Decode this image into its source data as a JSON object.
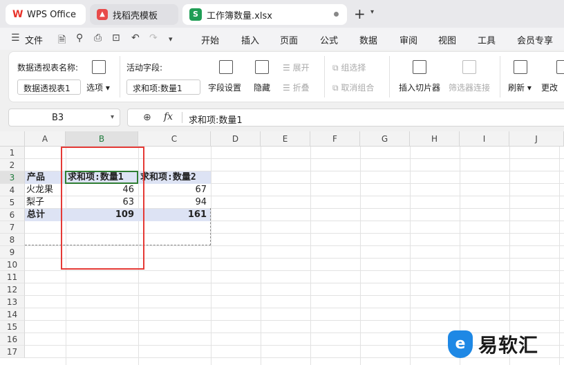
{
  "tabs": [
    {
      "label": "WPS Office",
      "icon": "wps-logo-icon"
    },
    {
      "label": "找稻壳模板",
      "icon": "template-logo-icon"
    },
    {
      "label": "工作簿数量.xlsx",
      "icon": "spreadsheet-s-icon"
    }
  ],
  "new_tab": "+",
  "menu": {
    "file": "文件",
    "items": [
      "开始",
      "插入",
      "页面",
      "公式",
      "数据",
      "审阅",
      "视图",
      "工具",
      "会员专享"
    ]
  },
  "ribbon": {
    "pivot_name_label": "数据透视表名称:",
    "pivot_name_value": "数据透视表1",
    "options_label": "选项",
    "active_field_label": "活动字段:",
    "active_field_value": "求和项:数量1",
    "field_settings": "字段设置",
    "hide": "隐藏",
    "expand": "展开",
    "collapse": "折叠",
    "group_selection": "组选择",
    "ungroup": "取消组合",
    "insert_slicer": "插入切片器",
    "filter_connections": "筛选器连接",
    "refresh": "刷新",
    "change_source": "更改"
  },
  "formula_bar": {
    "cell_ref": "B3",
    "fx": "fx",
    "value": "求和项:数量1"
  },
  "sheet": {
    "columns": [
      "A",
      "B",
      "C",
      "D",
      "E",
      "F",
      "G",
      "H",
      "I",
      "J"
    ],
    "rows": [
      "1",
      "2",
      "3",
      "4",
      "5",
      "6",
      "7",
      "8",
      "9",
      "10",
      "11",
      "12",
      "13",
      "14",
      "15",
      "16",
      "17"
    ],
    "selected_column": "B",
    "selected_row": "3",
    "pivot": {
      "header": [
        "产品",
        "求和项:数量1",
        "求和项:数量2"
      ],
      "rows": [
        [
          "火龙果",
          "46",
          "67"
        ],
        [
          "梨子",
          "63",
          "94"
        ]
      ],
      "total": [
        "总计",
        "109",
        "161"
      ]
    }
  },
  "watermark": {
    "text": "易软汇"
  },
  "colors": {
    "accent_green": "#2e7d32",
    "highlight_red": "#e53935",
    "pivot_fill": "#dde3f4"
  }
}
